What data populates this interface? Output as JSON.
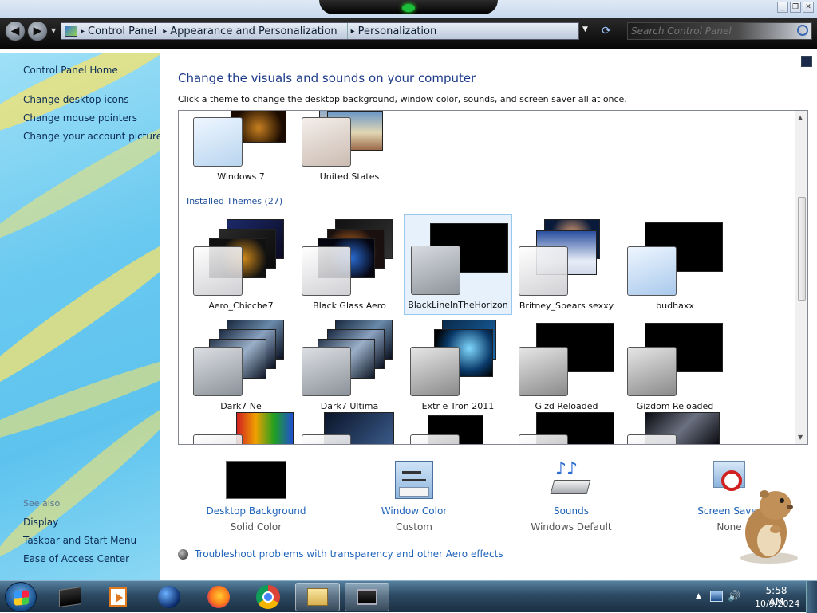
{
  "address": {
    "crumbs": [
      "Control Panel",
      "Appearance and Personalization",
      "Personalization"
    ],
    "search_placeholder": "Search Control Panel"
  },
  "sidebar": {
    "home": "Control Panel Home",
    "links": [
      "Change desktop icons",
      "Change mouse pointers",
      "Change your account picture"
    ],
    "see_also": "See also",
    "see_also_links": [
      "Display",
      "Taskbar and Start Menu",
      "Ease of Access Center"
    ]
  },
  "main": {
    "heading": "Change the visuals and sounds on your computer",
    "subtext": "Click a theme to change the desktop background, window color, sounds, and screen saver all at once.",
    "top_themes": [
      "Windows 7",
      "United States"
    ],
    "installed_label": "Installed Themes (27)",
    "installed_themes": [
      "Aero_Chicche7",
      "Black Glass Aero",
      "BlackLineInTheHorizon",
      "Britney_Spears sexxy",
      "budhaxx",
      "Dark7 Ne",
      "Dark7 Ultima",
      "Extr      e Tron 2011",
      "Gizd      Reloaded",
      "Gizdom Reloaded"
    ],
    "selected_theme": "BlackLineInTheHorizon"
  },
  "options": [
    {
      "label": "Desktop Background",
      "value": "Solid Color",
      "icon": "solid-color-icon"
    },
    {
      "label": "Window Color",
      "value": "Custom",
      "icon": "window-color-icon"
    },
    {
      "label": "Sounds",
      "value": "Windows Default",
      "icon": "sounds-icon"
    },
    {
      "label": "Screen Saver",
      "value": "None",
      "icon": "screen-saver-icon"
    }
  ],
  "troubleshoot": "Troubleshoot problems with transparency and other Aero effects",
  "taskbar": {
    "time": "5:58 AM",
    "date": "10/9/2024"
  },
  "colors": {
    "link": "#1c62b9",
    "heading": "#1c3a8a",
    "sidebar": "#6ac9f0",
    "taskbar": "#2d4a63"
  }
}
